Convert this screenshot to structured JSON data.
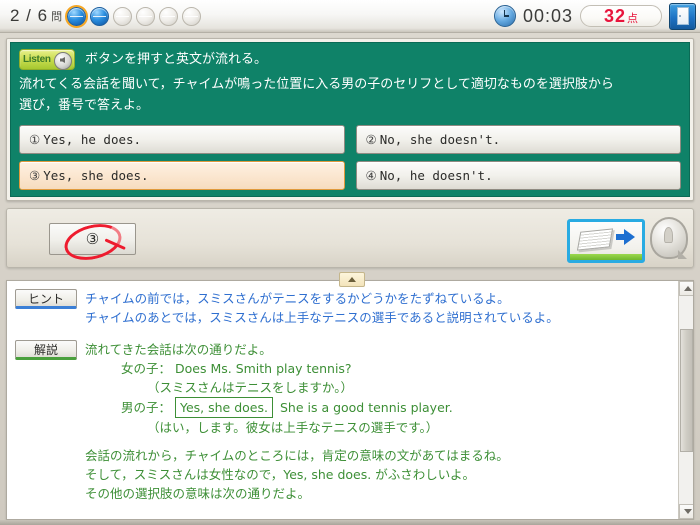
{
  "header": {
    "progress_text": "2 / 6",
    "progress_unit": "問",
    "dots": [
      {
        "state": "done",
        "current": false
      },
      {
        "state": "done",
        "current": true
      },
      {
        "state": "todo",
        "current": false
      },
      {
        "state": "todo",
        "current": false
      },
      {
        "state": "todo",
        "current": false
      },
      {
        "state": "todo",
        "current": false
      }
    ],
    "clock_icon": "clock-icon",
    "timer": "00:03",
    "score_value": "32",
    "score_unit": "点",
    "score_color": "#e8143c",
    "exit_icon": "exit-door-icon"
  },
  "question": {
    "listen_button_label": "Listen",
    "listen_icon": "speaker-icon",
    "instruction_line1": "ボタンを押すと英文が流れる。",
    "instruction_line2": "流れてくる会話を聞いて，チャイムが鳴った位置に入る男の子のセリフとして適切なものを選択肢から",
    "instruction_line3": "選び，番号で答えよ。",
    "panel_color": "#0f8268",
    "choices": [
      {
        "num": "①",
        "text": "Yes, he does.",
        "selected": false
      },
      {
        "num": "②",
        "text": "No, she doesn't.",
        "selected": false
      },
      {
        "num": "③",
        "text": "Yes, she does.",
        "selected": true
      },
      {
        "num": "④",
        "text": "No, he doesn't.",
        "selected": false
      }
    ]
  },
  "answer_bar": {
    "selected_answer": "③",
    "correct_mark": "red-circle-mark",
    "next_button_icon": "next-page-icon",
    "hint_button_icon": "lightbulb-icon"
  },
  "collapse_tab": {
    "icon": "chevron-up-icon"
  },
  "explanation": {
    "hint_label": "ヒント",
    "hint_lines": [
      "チャイムの前では，スミスさんがテニスをするかどうかをたずねているよ。",
      "チャイムのあとでは，スミスさんは上手なテニスの選手であると説明されているよ。"
    ],
    "expl_label": "解説",
    "expl_intro": "流れてきた会話は次の通りだよ。",
    "dialogue": {
      "girl_speaker": "女の子：",
      "girl_english": "Does Ms. Smith play tennis?",
      "girl_japanese": "（スミスさんはテニスをしますか。）",
      "boy_speaker": "男の子：",
      "boy_boxed": "Yes, she does.",
      "boy_rest": "She is a good tennis player.",
      "boy_japanese": "（はい，します。彼女は上手なテニスの選手です。）"
    },
    "summary_line1": "会話の流れから，チャイムのところには，肯定の意味の文があてはまるね。",
    "summary_line2": "そして，スミスさんは女性なので，Yes, she does. がふさわしいよ。",
    "summary_line3": "その他の選択肢の意味は次の通りだよ。"
  }
}
